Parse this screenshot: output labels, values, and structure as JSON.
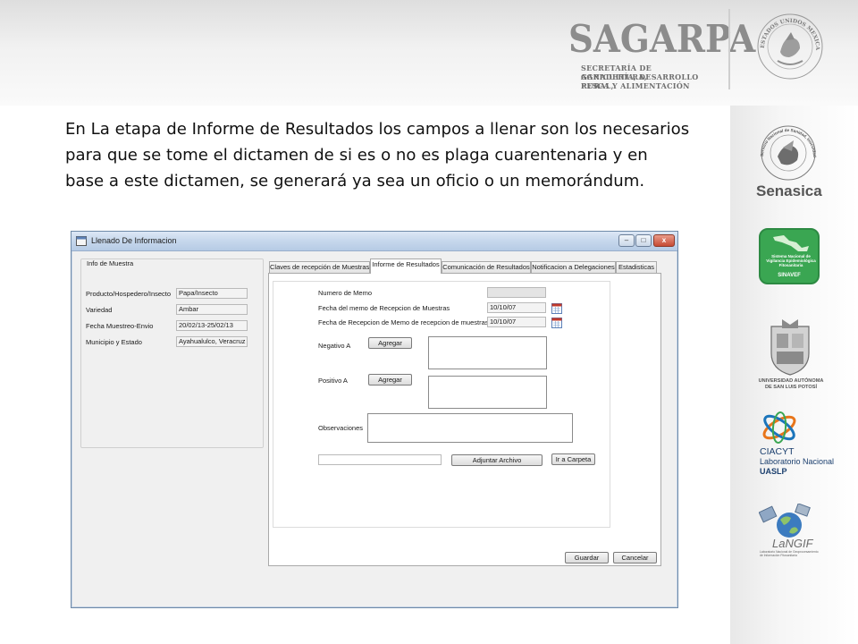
{
  "header": {
    "brand_title": "SAGARPA",
    "brand_subtitle_lines": [
      "SECRETARÍA DE AGRICULTURA,",
      "GANADERÍA, DESARROLLO RURAL,",
      "PESCA Y ALIMENTACIÓN"
    ],
    "seal_text": "ESTADOS UNIDOS MEXICANOS"
  },
  "slide": {
    "body_text": "En La etapa de Informe de Resultados los campos a llenar son los necesarios para que se tome el dictamen de si es o no es plaga cuarentenaria y en base a este dictamen, se generará ya sea un oficio o un memorándum."
  },
  "sidebar_logos": {
    "senasica": {
      "ring_text": "Servicio Nacional de Sanidad, Inocuidad y Calidad Agroalimentaria",
      "name": "Senasica"
    },
    "sinavef": {
      "lines": [
        "Sistema Nacional de",
        "Vigilancia Epidemiológica",
        "Fitosanitaria"
      ],
      "name": "SINAVEF"
    },
    "uaslp": {
      "lines": [
        "UNIVERSIDAD AUTÓNOMA",
        "DE SAN LUIS POTOSÍ"
      ]
    },
    "ciacyt": {
      "lines": [
        "CIACYT",
        "Laboratorio Nacional",
        "UASLP"
      ]
    },
    "langif": {
      "name": "LaNGIF",
      "lines": [
        "Laboratorio Nacional de Geoprocesamiento",
        "de Información Fitosanitaria"
      ]
    }
  },
  "window": {
    "title": "Llenado De Informacion",
    "controls": {
      "minimize": "–",
      "maximize": "□",
      "close": "x"
    },
    "info_group": {
      "legend": "Info de Muestra",
      "fields": [
        {
          "label": "Producto/Hospedero/Insecto",
          "value": "Papa/Insecto"
        },
        {
          "label": "Variedad",
          "value": "Ambar"
        },
        {
          "label": "Fecha Muestreo-Envio",
          "value": "20/02/13-25/02/13"
        },
        {
          "label": "Municipio y Estado",
          "value": "Ayahualulco, Veracruz de"
        }
      ]
    },
    "tabs": [
      "Claves de recepción de Muestras",
      "Informe de Resultados",
      "Comunicación de Resultados",
      "Notificacion a Delegaciones",
      "Estadisticas"
    ],
    "active_tab_index": 1,
    "form": {
      "numero_memo_label": "Numero de Memo",
      "numero_memo_value": "",
      "fecha_memo_label": "Fecha del memo de Recepcion de Muestras",
      "fecha_memo_value": "10/10/07",
      "fecha_recepcion_label": "Fecha de Recepcion de Memo de recepcion de muestras",
      "fecha_recepcion_value": "10/10/07",
      "negativo_label": "Negativo A",
      "positivo_label": "Positivo A",
      "agregar_label": "Agregar",
      "observaciones_label": "Observaciones",
      "file_path_value": "",
      "adjuntar_label": "Adjuntar Archivo",
      "ir_carpeta_label": "Ir a Carpeta"
    },
    "footer": {
      "guardar_label": "Guardar",
      "cancelar_label": "Cancelar"
    }
  },
  "colors": {
    "titlebar": "#c6d7ec",
    "window_bg": "#f0f0f0",
    "sinavef_green": "#3aa652",
    "ciacyt_orange": "#e8751a",
    "ciacyt_blue": "#1b75bb"
  }
}
